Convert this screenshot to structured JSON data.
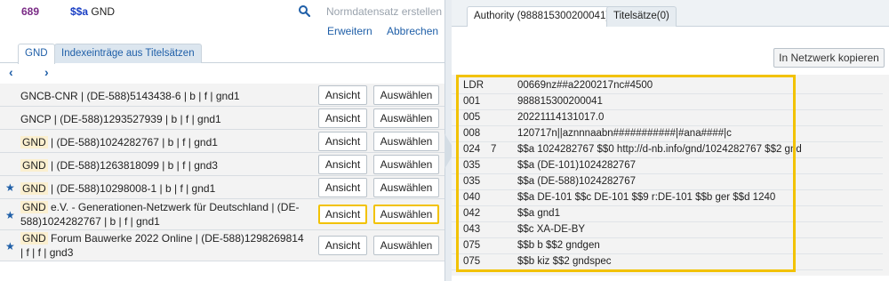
{
  "field": {
    "tag": "689",
    "subfield_code": "$$a",
    "subfield_value": "GND"
  },
  "actions": {
    "create_authority": "Normdatensatz erstellen",
    "expand": "Erweitern",
    "cancel": "Abbrechen"
  },
  "left_tabs": [
    "GND",
    "Indexeinträge aus Titelsätzen"
  ],
  "pager": {
    "prev": "‹",
    "next": "›"
  },
  "row_buttons": {
    "view": "Ansicht",
    "select": "Auswählen"
  },
  "results": [
    {
      "starred": false,
      "chip": "",
      "text": "GNCB-CNR | (DE-588)5143438-6 | b | f | gnd1",
      "highlight": false
    },
    {
      "starred": false,
      "chip": "",
      "text": "GNCP | (DE-588)1293527939 | b | f | gnd1",
      "highlight": false
    },
    {
      "starred": false,
      "chip": "GND",
      "text": " | (DE-588)1024282767 | b | f | gnd1",
      "highlight": false
    },
    {
      "starred": false,
      "chip": "GND",
      "text": " | (DE-588)1263818099 | b | f | gnd3",
      "highlight": false
    },
    {
      "starred": true,
      "chip": "GND",
      "text": " | (DE-588)10298008-1 | b | f | gnd1",
      "highlight": false
    },
    {
      "starred": true,
      "chip": "GND",
      "text": " e.V. - Generationen-Netzwerk für Deutschland | (DE-588)1024282767 | b | f | gnd1",
      "highlight": true
    },
    {
      "starred": true,
      "chip": "GND",
      "text": " Forum Bauwerke 2022 Online | (DE-588)1298269814 | f | f | gnd3",
      "highlight": false
    }
  ],
  "right_tabs": [
    "Authority (988815300200041)",
    "Titelsätze(0)"
  ],
  "copy_to_network": "In Netzwerk kopieren",
  "marc": [
    {
      "tag": "LDR",
      "ind": "",
      "value": "00669nz##a2200217nc#4500"
    },
    {
      "tag": "001",
      "ind": "",
      "value": "988815300200041"
    },
    {
      "tag": "005",
      "ind": "",
      "value": "20221114131017.0"
    },
    {
      "tag": "008",
      "ind": "",
      "value": "120717n||aznnnaabn###########|#ana####|c"
    },
    {
      "tag": "024",
      "ind": "7",
      "value": "$$a 1024282767 $$0 http://d-nb.info/gnd/1024282767 $$2 gnd"
    },
    {
      "tag": "035",
      "ind": "",
      "value": "$$a (DE-101)1024282767"
    },
    {
      "tag": "035",
      "ind": "",
      "value": "$$a (DE-588)1024282767"
    },
    {
      "tag": "040",
      "ind": "",
      "value": "$$a DE-101 $$c DE-101 $$9 r:DE-101 $$b ger $$d 1240"
    },
    {
      "tag": "042",
      "ind": "",
      "value": "$$a gnd1"
    },
    {
      "tag": "043",
      "ind": "",
      "value": "$$c XA-DE-BY"
    },
    {
      "tag": "075",
      "ind": "",
      "value": "$$b b $$2 gndgen"
    },
    {
      "tag": "075",
      "ind": "",
      "value": "$$b kiz $$2 gndspec"
    }
  ],
  "colors": {
    "accent": "#1f5fa8",
    "highlight": "#f2c200",
    "tag": "#7a2b86"
  }
}
